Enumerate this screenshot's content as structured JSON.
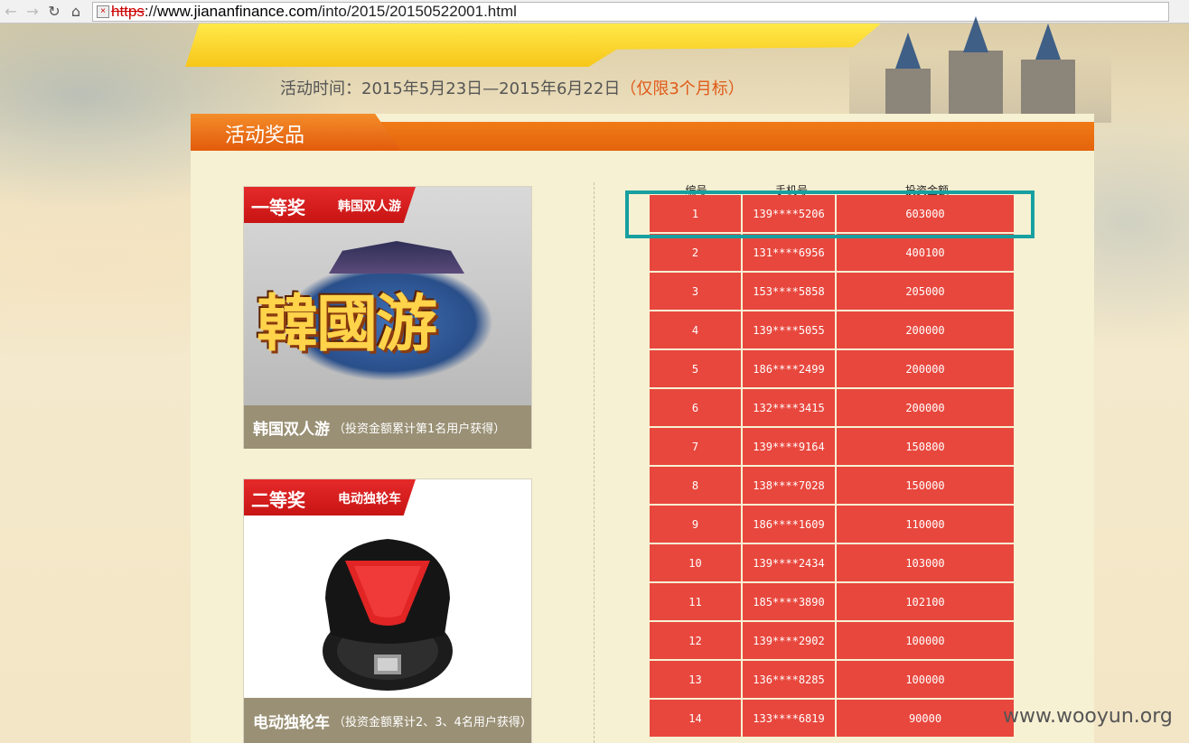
{
  "browser": {
    "url_scheme": "https",
    "url_sep": "://",
    "url_host": "www.jiananfinance.com",
    "url_path": "/into/2015/20150522001.html",
    "back_icon": "arrow-left-icon",
    "forward_icon": "arrow-right-icon",
    "reload_icon": "reload-icon",
    "home_icon": "home-icon"
  },
  "event": {
    "time_label": "活动时间：2015年5月23日—2015年6月22日",
    "limit_note": "（仅限3个月标）"
  },
  "section": {
    "title": "活动奖品"
  },
  "prizes": [
    {
      "rank": "一等奖",
      "item": "韩国双人游",
      "art_text": "韓國游",
      "caption_main": "韩国双人游",
      "caption_note": "（投资金额累计第1名用户获得）"
    },
    {
      "rank": "二等奖",
      "item": "电动独轮车",
      "caption_main": "电动独轮车",
      "caption_note": "（投资金额累计2、3、4名用户获得）"
    }
  ],
  "table": {
    "headers": [
      "编号",
      "手机号",
      "投资金额"
    ],
    "rows": [
      [
        "1",
        "139****5206",
        "603000"
      ],
      [
        "2",
        "131****6956",
        "400100"
      ],
      [
        "3",
        "153****5858",
        "205000"
      ],
      [
        "4",
        "139****5055",
        "200000"
      ],
      [
        "5",
        "186****2499",
        "200000"
      ],
      [
        "6",
        "132****3415",
        "200000"
      ],
      [
        "7",
        "139****9164",
        "150800"
      ],
      [
        "8",
        "138****7028",
        "150000"
      ],
      [
        "9",
        "186****1609",
        "110000"
      ],
      [
        "10",
        "139****2434",
        "103000"
      ],
      [
        "11",
        "185****3890",
        "102100"
      ],
      [
        "12",
        "139****2902",
        "100000"
      ],
      [
        "13",
        "136****8285",
        "100000"
      ],
      [
        "14",
        "133****6819",
        "90000"
      ]
    ]
  },
  "colors": {
    "accent_orange": "#e4640c",
    "table_red": "#e8473d",
    "highlight_teal": "#17a0a0"
  },
  "watermark": "www.wooyun.org"
}
